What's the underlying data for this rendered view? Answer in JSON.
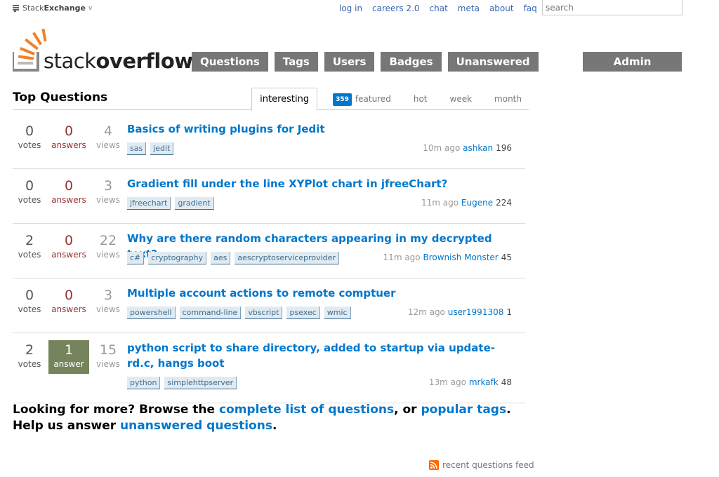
{
  "topbar": {
    "brand_prefix": "Stack",
    "brand_suffix": "Exchange",
    "links": [
      "log in",
      "careers 2.0",
      "chat",
      "meta",
      "about",
      "faq"
    ],
    "search_placeholder": "search"
  },
  "logo": {
    "part1": "stack",
    "part2": "overflow"
  },
  "nav": {
    "items": [
      "Questions",
      "Tags",
      "Users",
      "Badges",
      "Unanswered"
    ],
    "admin": "Admin Console"
  },
  "page": {
    "title": "Top Questions",
    "tabs": [
      {
        "label": "interesting",
        "active": true
      },
      {
        "label": "featured",
        "badge": "359"
      },
      {
        "label": "hot"
      },
      {
        "label": "week"
      },
      {
        "label": "month"
      }
    ]
  },
  "questions": [
    {
      "votes": "0",
      "votes_label": "votes",
      "answers": "0",
      "answers_label": "answers",
      "views": "4",
      "views_label": "views",
      "title": "Basics of writing plugins for Jedit",
      "tags": [
        "sas",
        "jedit"
      ],
      "time": "10m ago",
      "user": "ashkan",
      "rep": "196"
    },
    {
      "votes": "0",
      "votes_label": "votes",
      "answers": "0",
      "answers_label": "answers",
      "views": "3",
      "views_label": "views",
      "title": "Gradient fill under the line XYPlot chart in jfreeChart?",
      "tags": [
        "jfreechart",
        "gradient"
      ],
      "time": "11m ago",
      "user": "Eugene",
      "rep": "224"
    },
    {
      "votes": "2",
      "votes_label": "votes",
      "answers": "0",
      "answers_label": "answers",
      "views": "22",
      "views_label": "views",
      "title": "Why are there random characters appearing in my decrypted text?",
      "tags": [
        "c#",
        "cryptography",
        "aes",
        "aescryptoserviceprovider"
      ],
      "time": "11m ago",
      "user": "Brownish Monster",
      "rep": "45"
    },
    {
      "votes": "0",
      "votes_label": "votes",
      "answers": "0",
      "answers_label": "answers",
      "views": "3",
      "views_label": "views",
      "title": "Multiple account actions to remote comptuer",
      "tags": [
        "powershell",
        "command-line",
        "vbscript",
        "psexec",
        "wmic"
      ],
      "time": "12m ago",
      "user": "user1991308",
      "rep": "1"
    },
    {
      "votes": "2",
      "votes_label": "votes",
      "answers": "1",
      "answers_label": "answer",
      "views": "15",
      "views_label": "views",
      "title": "python script to share directory, added to startup via update-rd.c, hangs boot",
      "tags": [
        "python",
        "simplehttpserver"
      ],
      "time": "13m ago",
      "user": "mrkafk",
      "rep": "48"
    }
  ],
  "more": {
    "text1": "Looking for more? Browse the ",
    "link1": "complete list of questions",
    "text2": ", or ",
    "link2": "popular tags",
    "text3": ". Help us answer ",
    "link3": "unanswered questions",
    "text4": "."
  },
  "feed": {
    "label": "recent questions feed"
  },
  "colors": {
    "link": "#0077cc",
    "nav_bg": "#777777",
    "accepted": "#75845c",
    "answers": "#993333",
    "logo_orange": "#f48024"
  }
}
